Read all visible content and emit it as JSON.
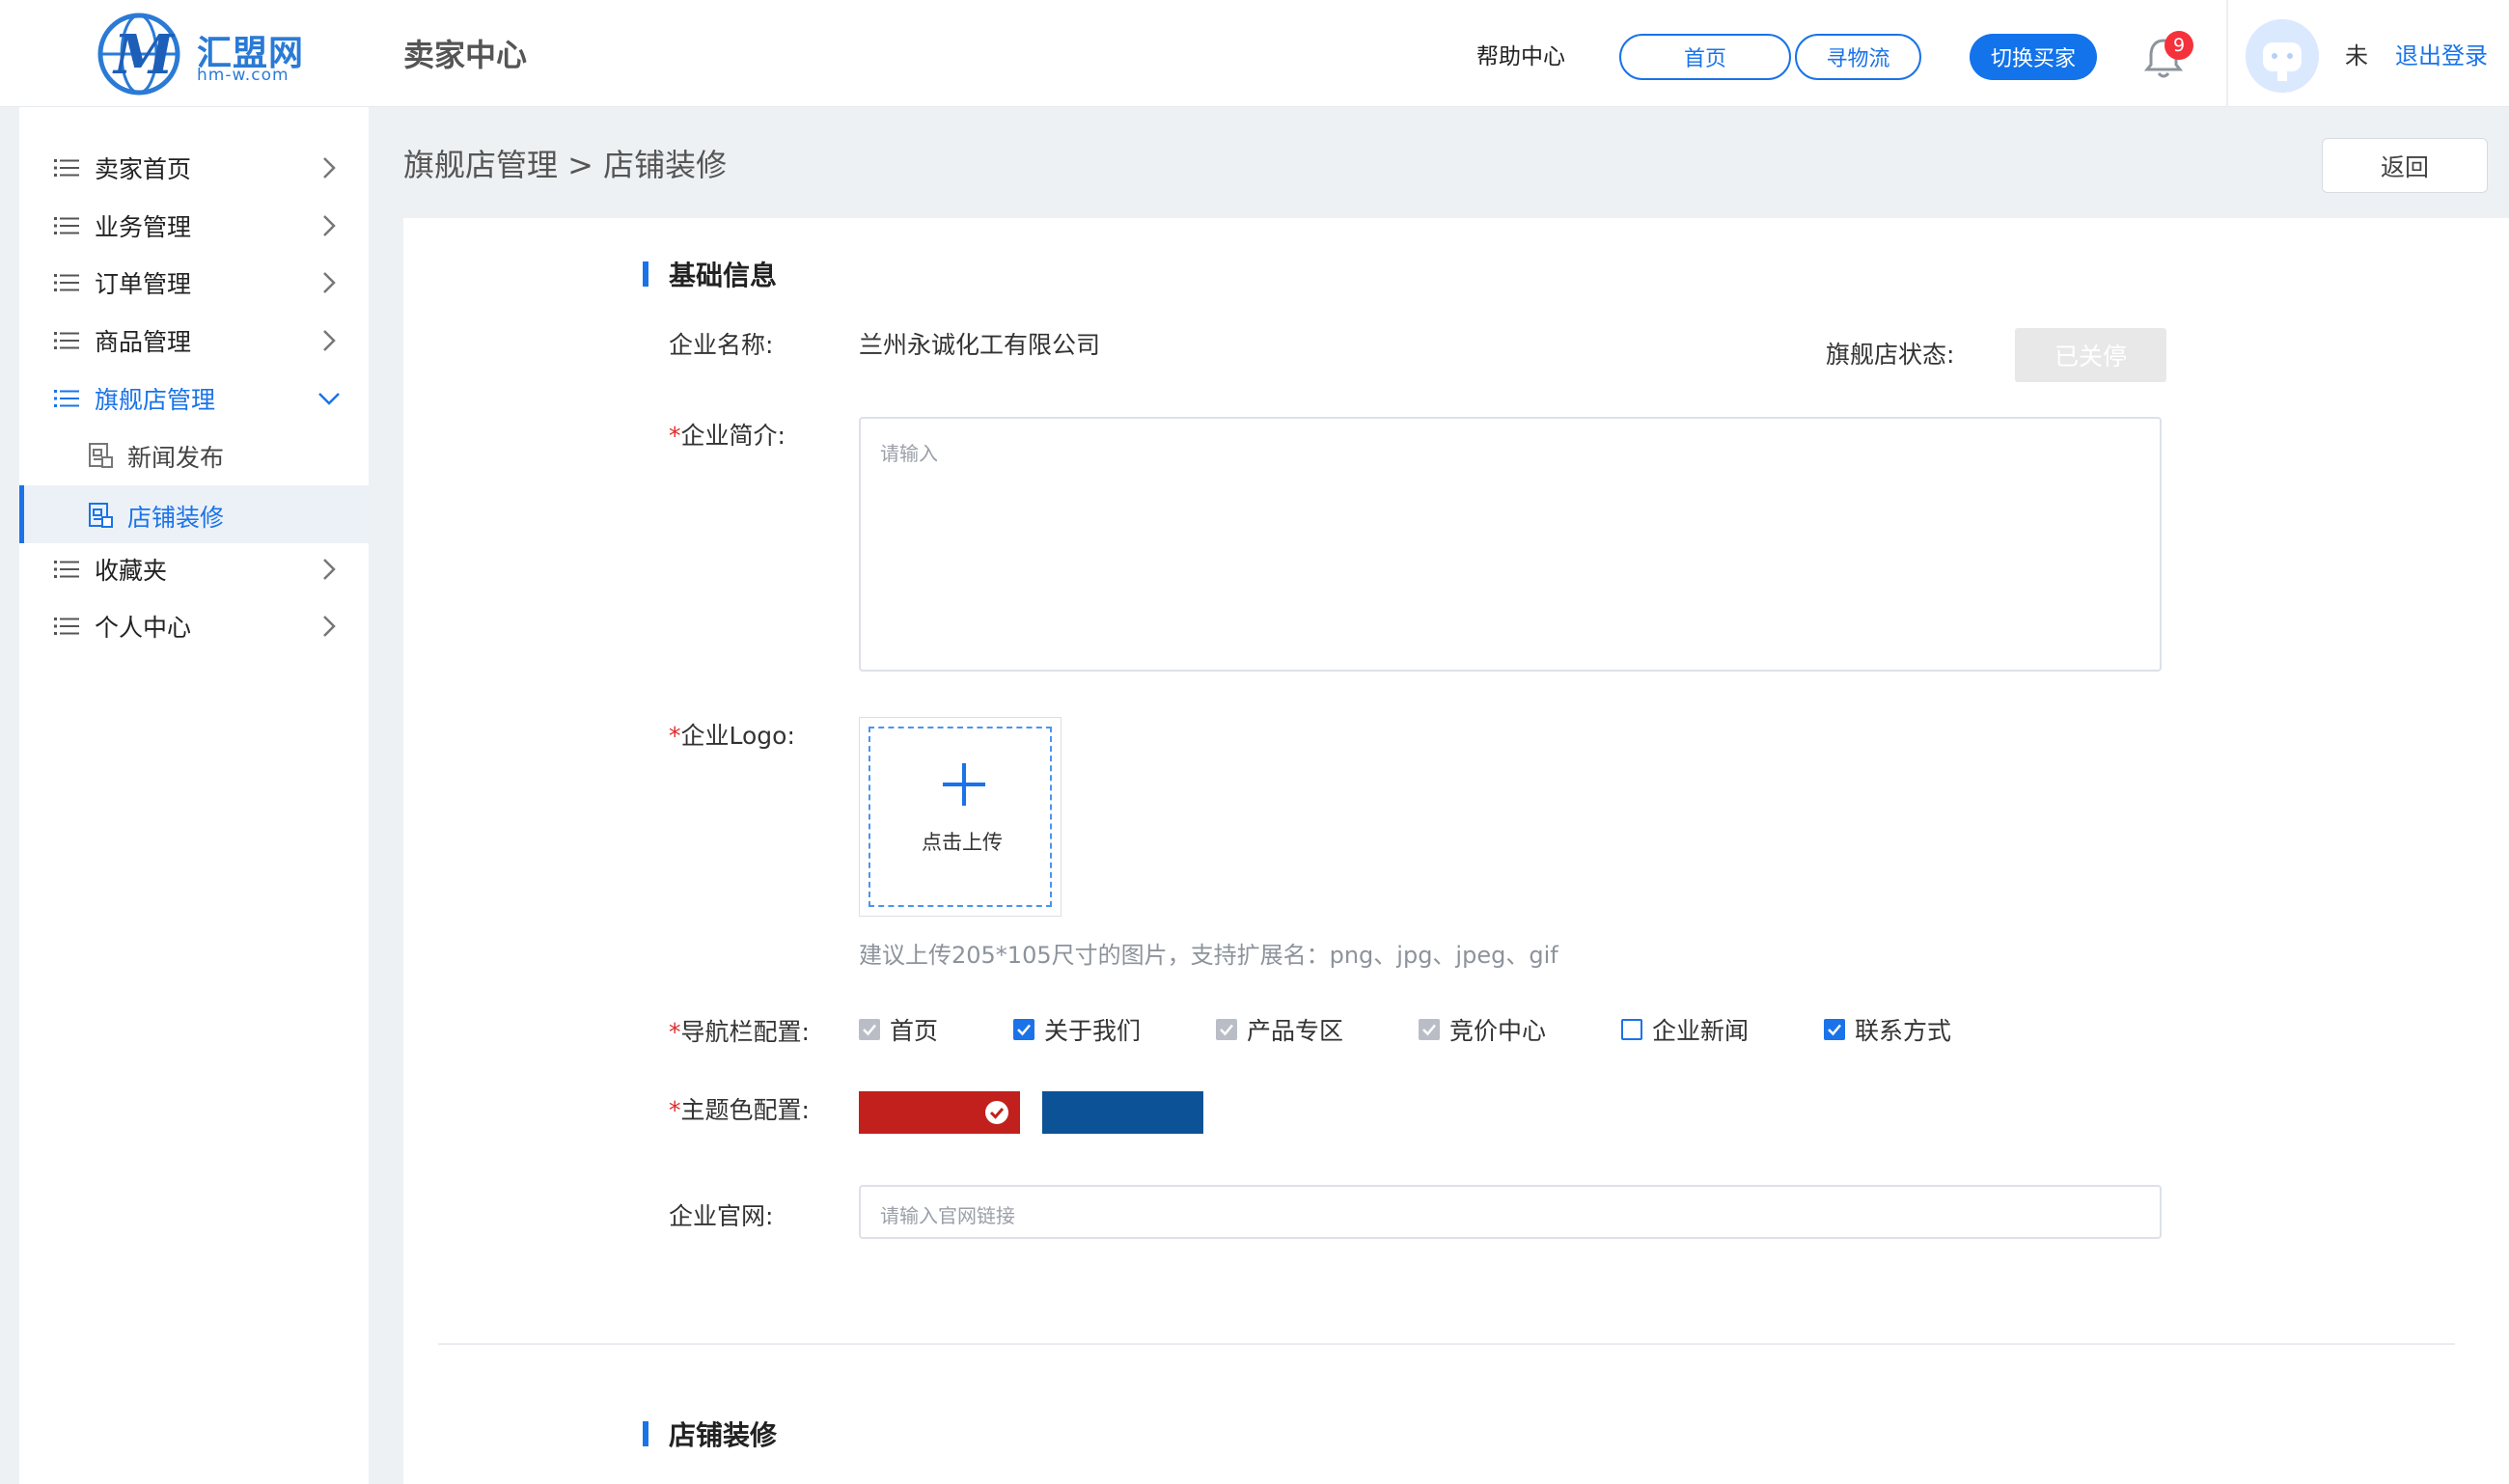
{
  "header": {
    "logo_brand": "汇盟网",
    "logo_domain": "hm-w.com",
    "title": "卖家中心",
    "help_label": "帮助中心",
    "home_label": "首页",
    "logistics_label": "寻物流",
    "switch_label": "切换买家",
    "notification_count": "9",
    "user_name": "未",
    "logout_label": "退出登录"
  },
  "sidebar": {
    "items": [
      {
        "label": "卖家首页"
      },
      {
        "label": "业务管理"
      },
      {
        "label": "订单管理"
      },
      {
        "label": "商品管理"
      },
      {
        "label": "旗舰店管理"
      },
      {
        "label": "收藏夹"
      },
      {
        "label": "个人中心"
      }
    ],
    "subitems": [
      {
        "label": "新闻发布"
      },
      {
        "label": "店铺装修"
      }
    ]
  },
  "main": {
    "breadcrumb": "旗舰店管理 > 店铺装修",
    "back_label": "返回",
    "section_basic": "基础信息",
    "company_name_label": "企业名称:",
    "company_name_value": "兰州永诚化工有限公司",
    "store_status_label": "旗舰店状态:",
    "store_status_value": "已关停",
    "required_mark": "*",
    "intro_label": "企业简介:",
    "intro_placeholder": "请输入",
    "logo_label": "企业Logo:",
    "upload_label": "点击上传",
    "upload_hint": "建议上传205*105尺寸的图片，支持扩展名：png、jpg、jpeg、gif",
    "nav_label": "导航栏配置:",
    "nav_options": [
      {
        "label": "首页",
        "state": "checked-disabled"
      },
      {
        "label": "关于我们",
        "state": "checked"
      },
      {
        "label": "产品专区",
        "state": "checked-disabled"
      },
      {
        "label": "竞价中心",
        "state": "checked-disabled"
      },
      {
        "label": "企业新闻",
        "state": "unchecked"
      },
      {
        "label": "联系方式",
        "state": "checked"
      }
    ],
    "theme_label": "主题色配置:",
    "theme_colors": [
      {
        "color": "#c2201d",
        "selected": true
      },
      {
        "color": "#0c5297",
        "selected": false
      }
    ],
    "website_label": "企业官网:",
    "website_placeholder": "请输入官网链接",
    "section_decor": "店铺装修"
  },
  "colors": {
    "accent": "#1a73e8",
    "required": "#e02b2b",
    "badge": "#f5313b"
  }
}
